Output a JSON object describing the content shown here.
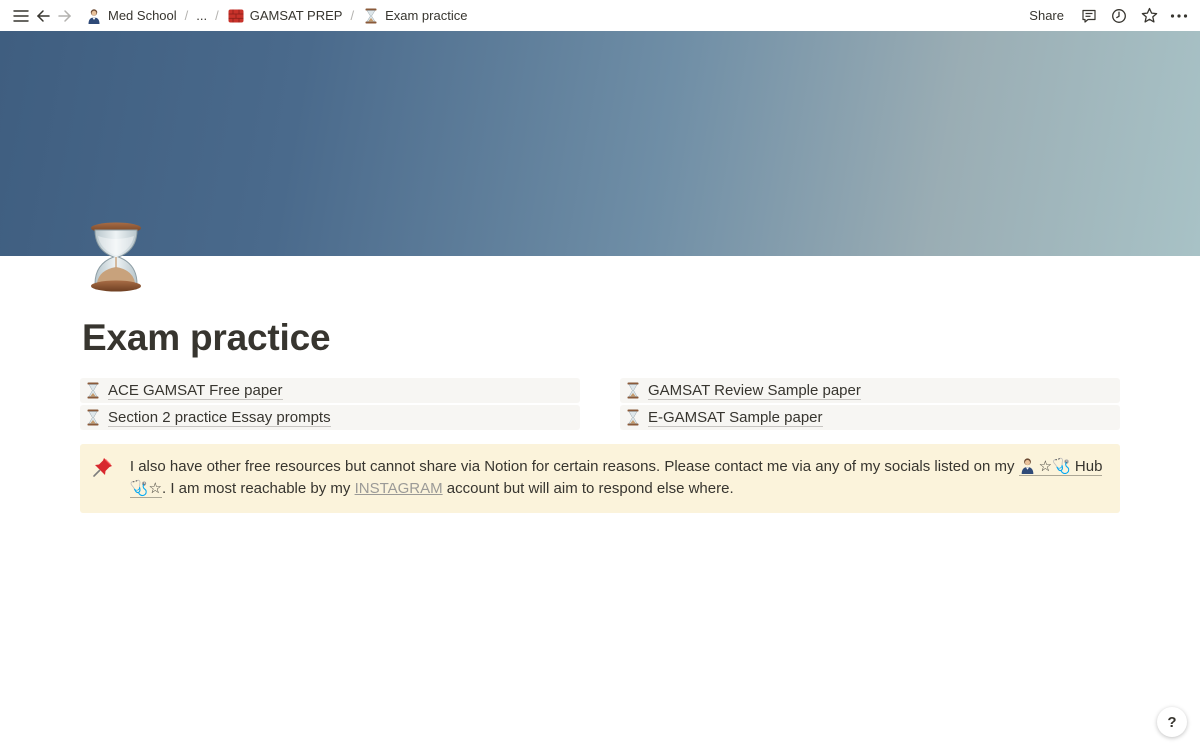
{
  "breadcrumbs": [
    {
      "label": "Med School",
      "icon": "doctor-emoji-icon"
    },
    {
      "label": "...",
      "icon": null
    },
    {
      "label": "GAMSAT PREP",
      "icon": "red-brick-icon"
    },
    {
      "label": "Exam practice",
      "icon": "hourglass-icon"
    }
  ],
  "topbar": {
    "share_label": "Share",
    "right_icons": [
      "comment-icon",
      "history-icon",
      "star-icon",
      "more-icon"
    ]
  },
  "page": {
    "title": "Exam practice",
    "icon": "hourglass-icon"
  },
  "links": {
    "left": [
      {
        "label": "ACE GAMSAT Free paper",
        "icon": "hourglass-icon"
      },
      {
        "label": "Section 2 practice Essay prompts",
        "icon": "hourglass-icon"
      }
    ],
    "right": [
      {
        "label": "GAMSAT Review Sample paper",
        "icon": "hourglass-icon"
      },
      {
        "label": "E-GAMSAT Sample paper",
        "icon": "hourglass-icon"
      }
    ]
  },
  "callout": {
    "icon": "pushpin-icon",
    "text_before": "I also have other free resources but cannot share via Notion for certain reasons. Please contact me via any of my socials listed on my ",
    "mention": "☆🩺 Hub 🩺☆",
    "text_middle": ". I am most reachable by my ",
    "link": "INSTAGRAM",
    "text_after": " account but will aim to respond else where.",
    "background": "#fbf3db"
  },
  "help_label": "?",
  "colors": {
    "cover_start": "#3f5e80",
    "cover_end": "#a8c2c6",
    "link_block_bg": "#f7f6f3",
    "text": "#37352f"
  }
}
